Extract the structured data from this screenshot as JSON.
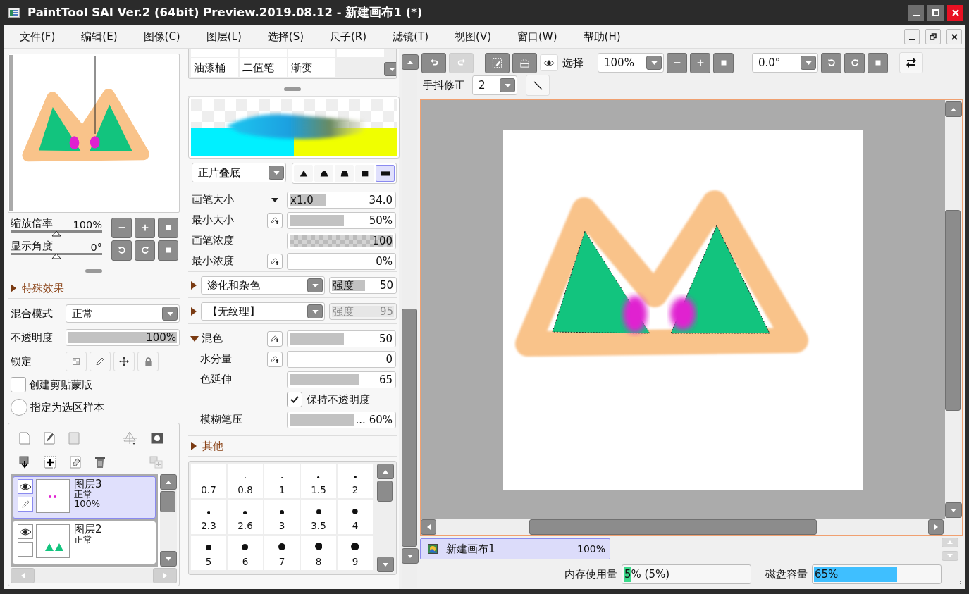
{
  "window": {
    "title": "PaintTool SAI Ver.2 (64bit) Preview.2019.08.12 - 新建画布1 (*)"
  },
  "menu": [
    "文件(F)",
    "编辑(E)",
    "图像(C)",
    "图层(L)",
    "选择(S)",
    "尺子(R)",
    "滤镜(T)",
    "视图(V)",
    "窗口(W)",
    "帮助(H)"
  ],
  "navigator": {
    "zoom": {
      "label": "缩放倍率",
      "reading": "100%",
      "level": 0.5
    },
    "angle": {
      "label": "显示角度",
      "reading": "0°",
      "level": 0.5
    }
  },
  "effects_section": {
    "label": "特殊效果",
    "expanded": false
  },
  "layer_props": {
    "blend_label": "混合模式",
    "blend_value": "正常",
    "opacity": {
      "label": "不透明度",
      "reading": "100%",
      "level": 1
    },
    "lock_label": "锁定",
    "clipping": {
      "label": "创建剪贴蒙版",
      "checked": false
    },
    "selection_source": {
      "label": "指定为选区样本",
      "checked": false
    }
  },
  "layers": [
    {
      "name": "图层3",
      "mode": "正常",
      "opacity": "100%",
      "selected": true,
      "visible": true
    },
    {
      "name": "图层2",
      "mode": "正常",
      "selected": false,
      "visible": true
    }
  ],
  "tools": [
    "油漆桶",
    "二值笔",
    "渐变"
  ],
  "brush": {
    "blend": "正片叠底",
    "tip_shapes": [
      {
        "selected": false
      },
      {
        "selected": false
      },
      {
        "selected": false
      },
      {
        "selected": false
      },
      {
        "selected": true
      }
    ],
    "rows": [
      {
        "kind": "slider",
        "label": "画笔大小",
        "caret": true,
        "pressure": false,
        "prefix": "x1.0",
        "reading": "34.0",
        "level": 0.34
      },
      {
        "kind": "slider",
        "label": "最小大小",
        "pressure": true,
        "reading": "50%",
        "level": 0.5
      },
      {
        "kind": "checker",
        "label": "画笔浓度",
        "pressure": false,
        "reading": "100",
        "level": 1
      },
      {
        "kind": "slider",
        "label": "最小浓度",
        "pressure": true,
        "reading": "0%",
        "level": 0
      },
      {
        "kind": "effect",
        "expanded": false,
        "value": "渗化和杂色",
        "strength_label": "强度",
        "reading": "50",
        "level": 0.5,
        "disabled": false
      },
      {
        "kind": "effect",
        "expanded": false,
        "value": "【无纹理】",
        "strength_label": "强度",
        "reading": "95",
        "level": 0.95,
        "disabled": true
      },
      {
        "kind": "group",
        "label": "混色",
        "expanded": true,
        "pressure": true,
        "reading": "50",
        "level": 0.5,
        "children": [
          {
            "kind": "slider",
            "label": "水分量",
            "pressure": true,
            "reading": "0",
            "level": 0
          },
          {
            "kind": "slider",
            "label": "色延伸",
            "pressure": false,
            "reading": "65",
            "level": 0.65
          },
          {
            "kind": "checkbox",
            "label": "保持不透明度",
            "checked": true
          },
          {
            "kind": "slider",
            "label": "模糊笔压",
            "pressure": false,
            "reading": "... 60%",
            "level": 0.6
          }
        ]
      },
      {
        "kind": "section",
        "label": "其他",
        "expanded": false
      }
    ],
    "sizes": [
      "0.7",
      "0.8",
      "1",
      "1.5",
      "2",
      "2.3",
      "2.6",
      "3",
      "3.5",
      "4",
      "5",
      "6",
      "7",
      "8",
      "9"
    ]
  },
  "canvas_toolbar": {
    "select_label": "选择",
    "zoom": "100%",
    "angle": "0.0°",
    "stabilizer_label": "手抖修正",
    "stabilizer": "2"
  },
  "canvas_tabs": [
    {
      "name": "新建画布1",
      "zoom": "100%",
      "selected": true
    }
  ],
  "status": {
    "memory": {
      "label": "内存使用量",
      "reading": "5% (5%)",
      "level": 0.05
    },
    "disk": {
      "label": "磁盘容量",
      "reading": "65%",
      "level": 0.65
    }
  }
}
